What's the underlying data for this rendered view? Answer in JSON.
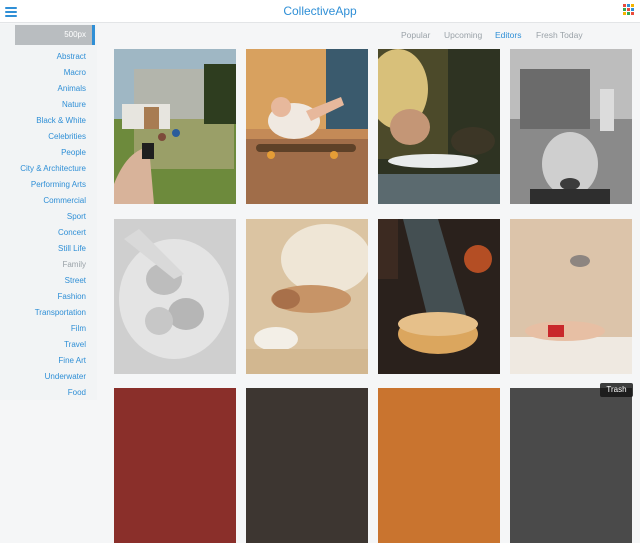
{
  "app": {
    "title": "CollectiveApp"
  },
  "sidebar": {
    "header": "500px",
    "categories": [
      "Abstract",
      "Macro",
      "Animals",
      "Nature",
      "Black & White",
      "Celebrities",
      "People",
      "City & Architecture",
      "Performing Arts",
      "Commercial",
      "Sport",
      "Concert",
      "Still Life",
      "Family",
      "Street",
      "Fashion",
      "Transportation",
      "Film",
      "Travel",
      "Fine Art",
      "Underwater",
      "Food"
    ],
    "muted_category": "Family"
  },
  "tabs": [
    "Popular",
    "Upcoming",
    "Editors",
    "Fresh Today"
  ],
  "active_tab": "Editors",
  "photos": [
    {
      "name": "photo-backyard-snapshot-in-hand"
    },
    {
      "name": "photo-baby-on-skateboard"
    },
    {
      "name": "photo-child-with-hedgehog"
    },
    {
      "name": "photo-laughing-boy-bw"
    },
    {
      "name": "photo-two-women-lying-bw"
    },
    {
      "name": "photo-woman-in-splashing-wave"
    },
    {
      "name": "photo-kitchen-cauldron-light"
    },
    {
      "name": "photo-woman-in-red-with-cat"
    },
    {
      "name": "photo-row3-col1"
    },
    {
      "name": "photo-row3-col2"
    },
    {
      "name": "photo-row3-col3"
    },
    {
      "name": "photo-row3-col4"
    }
  ],
  "trash_label": "Trash",
  "colors": {
    "accent": "#2f8fd6",
    "sidebar_bg": "#f2f4f5",
    "header_gray": "#b9bdc0"
  }
}
